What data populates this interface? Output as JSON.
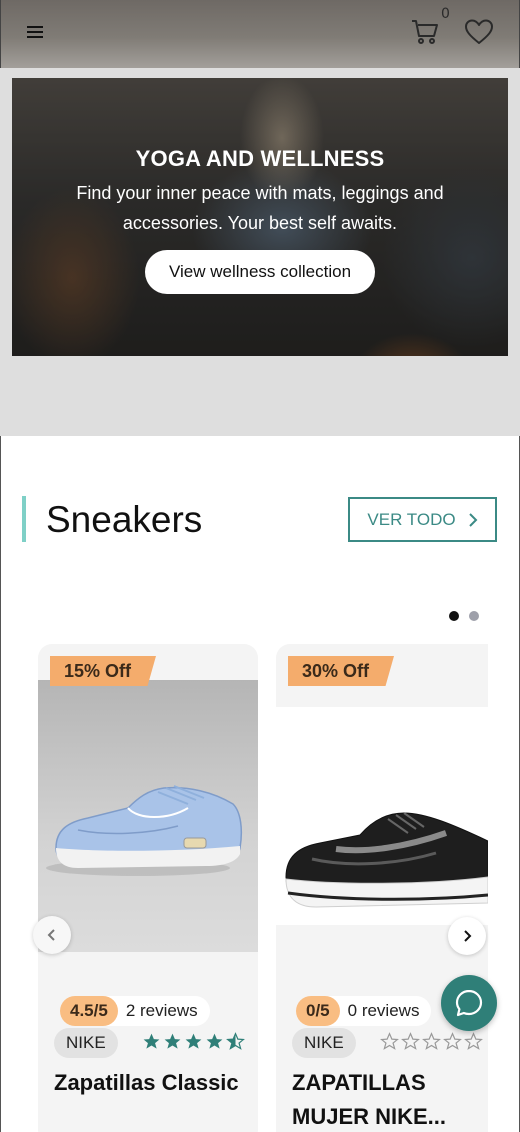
{
  "header": {
    "menu_icon": "hamburger-menu-icon",
    "cart_icon": "cart-icon",
    "cart_count": "0",
    "wishlist_icon": "heart-icon"
  },
  "hero": {
    "title": "YOGA AND WELLNESS",
    "subtitle": "Find your inner peace with mats, leggings and accessories. Your best self awaits.",
    "cta_label": "View wellness collection"
  },
  "section": {
    "title": "Sneakers",
    "see_all_label": "VER TODO",
    "accent_color": "#7fd0c7",
    "button_color": "#3b8a85"
  },
  "carousel": {
    "pages": 2,
    "active_page": 1
  },
  "products": [
    {
      "discount": "15% Off",
      "rating": "4.5/5",
      "reviews": "2 reviews",
      "brand": "NIKE",
      "stars": 4.5,
      "name": "Zapatillas Classic"
    },
    {
      "discount": "30% Off",
      "rating": "0/5",
      "reviews": "0 reviews",
      "brand": "NIKE",
      "stars": 0,
      "name": "ZAPATILLAS MUJER NIKE..."
    }
  ],
  "colors": {
    "discount_badge": "#f4ac6c",
    "star": "#2f7f78",
    "chat_button": "#2f7f78"
  },
  "chat_icon": "chat-bubble-icon"
}
